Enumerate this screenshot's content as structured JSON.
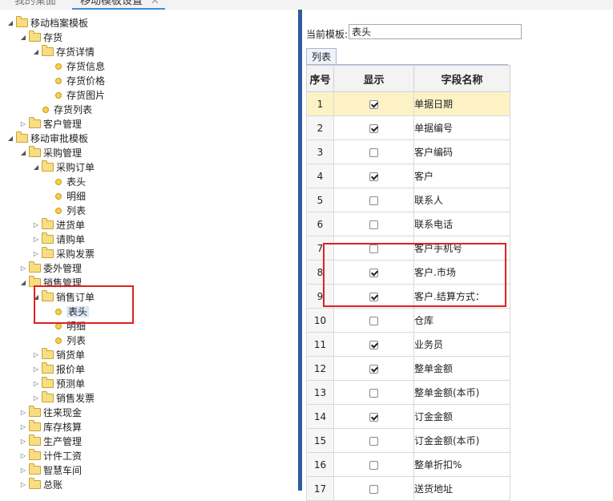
{
  "tabs": [
    {
      "label": "我的桌面"
    },
    {
      "label": "移动模板设置",
      "close": "✕"
    }
  ],
  "tree": {
    "nodes": [
      {
        "label": "移动档案模板",
        "toggle": "◢",
        "kind": "folder"
      },
      {
        "label": "存货",
        "toggle": "◢",
        "kind": "folder"
      },
      {
        "label": "存货详情",
        "toggle": "◢",
        "kind": "folder"
      },
      {
        "label": "存货信息",
        "toggle": "",
        "kind": "leaf"
      },
      {
        "label": "存货价格",
        "toggle": "",
        "kind": "leaf"
      },
      {
        "label": "存货图片",
        "toggle": "",
        "kind": "leaf"
      },
      {
        "label": "存货列表",
        "toggle": "",
        "kind": "leaf"
      },
      {
        "label": "客户管理",
        "toggle": "▷",
        "kind": "folder"
      },
      {
        "label": "移动审批模板",
        "toggle": "◢",
        "kind": "folder"
      },
      {
        "label": "采购管理",
        "toggle": "◢",
        "kind": "folder"
      },
      {
        "label": "采购订单",
        "toggle": "◢",
        "kind": "folder"
      },
      {
        "label": "表头",
        "toggle": "",
        "kind": "leaf"
      },
      {
        "label": "明细",
        "toggle": "",
        "kind": "leaf"
      },
      {
        "label": "列表",
        "toggle": "",
        "kind": "leaf"
      },
      {
        "label": "进货单",
        "toggle": "▷",
        "kind": "folder"
      },
      {
        "label": "请购单",
        "toggle": "▷",
        "kind": "folder"
      },
      {
        "label": "采购发票",
        "toggle": "▷",
        "kind": "folder"
      },
      {
        "label": "委外管理",
        "toggle": "▷",
        "kind": "folder"
      },
      {
        "label": "销售管理",
        "toggle": "◢",
        "kind": "folder"
      },
      {
        "label": "销售订单",
        "toggle": "◢",
        "kind": "folder"
      },
      {
        "label": "表头",
        "toggle": "",
        "kind": "leaf",
        "selected": true
      },
      {
        "label": "明细",
        "toggle": "",
        "kind": "leaf"
      },
      {
        "label": "列表",
        "toggle": "",
        "kind": "leaf"
      },
      {
        "label": "销货单",
        "toggle": "▷",
        "kind": "folder"
      },
      {
        "label": "报价单",
        "toggle": "▷",
        "kind": "folder"
      },
      {
        "label": "预测单",
        "toggle": "▷",
        "kind": "folder"
      },
      {
        "label": "销售发票",
        "toggle": "▷",
        "kind": "folder"
      },
      {
        "label": "往来现金",
        "toggle": "▷",
        "kind": "folder"
      },
      {
        "label": "库存核算",
        "toggle": "▷",
        "kind": "folder"
      },
      {
        "label": "生产管理",
        "toggle": "▷",
        "kind": "folder"
      },
      {
        "label": "计件工资",
        "toggle": "▷",
        "kind": "folder"
      },
      {
        "label": "智慧车间",
        "toggle": "▷",
        "kind": "folder"
      },
      {
        "label": "总账",
        "toggle": "▷",
        "kind": "folder"
      }
    ]
  },
  "template": {
    "label": "当前模板:",
    "value": "表头"
  },
  "subtab": {
    "label": "列表"
  },
  "grid": {
    "headers": [
      "序号",
      "显示",
      "字段名称"
    ],
    "rows": [
      {
        "no": "1",
        "checked": true,
        "field": "单据日期"
      },
      {
        "no": "2",
        "checked": true,
        "field": "单据编号"
      },
      {
        "no": "3",
        "checked": false,
        "field": "客户编码"
      },
      {
        "no": "4",
        "checked": true,
        "field": "客户"
      },
      {
        "no": "5",
        "checked": false,
        "field": "联系人"
      },
      {
        "no": "6",
        "checked": false,
        "field": "联系电话"
      },
      {
        "no": "7",
        "checked": false,
        "field": "客户手机号"
      },
      {
        "no": "8",
        "checked": true,
        "field": "客户.市场"
      },
      {
        "no": "9",
        "checked": true,
        "field": "客户.结算方式："
      },
      {
        "no": "10",
        "checked": false,
        "field": "仓库"
      },
      {
        "no": "11",
        "checked": true,
        "field": "业务员"
      },
      {
        "no": "12",
        "checked": true,
        "field": "整单金额"
      },
      {
        "no": "13",
        "checked": false,
        "field": "整单金额(本币)"
      },
      {
        "no": "14",
        "checked": true,
        "field": "订金金额"
      },
      {
        "no": "15",
        "checked": false,
        "field": "订金金额(本币)"
      },
      {
        "no": "16",
        "checked": false,
        "field": "整单折扣%"
      },
      {
        "no": "17",
        "checked": false,
        "field": "送货地址"
      }
    ]
  },
  "colors": {
    "annotation": "#e02020",
    "splitter": "#2f5c9c",
    "highlight_row": "#fcf2c6"
  }
}
